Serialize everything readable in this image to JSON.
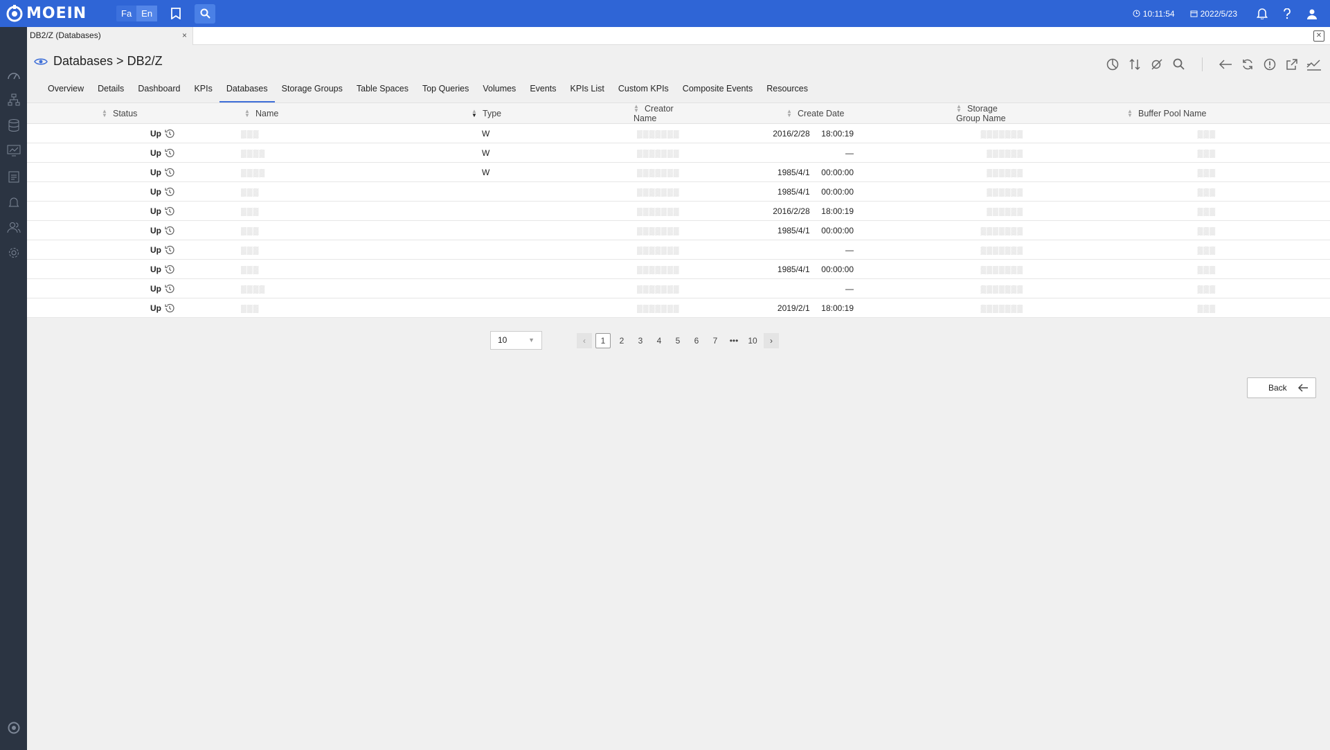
{
  "app": {
    "brand": "MOEIN",
    "langs": [
      "Fa",
      "En"
    ],
    "active_lang": "En",
    "time": "10:11:54",
    "date": "2022/5/23"
  },
  "tab": {
    "title": "DB2/Z (Databases)",
    "close": "×"
  },
  "page": {
    "title": "Databases > DB2/Z"
  },
  "subtabs": [
    "Overview",
    "Details",
    "Dashboard",
    "KPIs",
    "Databases",
    "Storage Groups",
    "Table Spaces",
    "Top Queries",
    "Volumes",
    "Events",
    "KPIs List",
    "Custom KPIs",
    "Composite Events",
    "Resources"
  ],
  "active_subtab": "Databases",
  "columns": [
    "Status",
    "Name",
    "Type",
    "Creator Name",
    "Create Date",
    "Storage Group Name",
    "Buffer Pool Name"
  ],
  "rows": [
    {
      "status": "Up",
      "name": "▒▒▒",
      "type": "W",
      "creator": "▒▒▒▒▒▒▒",
      "date": "2016/2/28     18:00:19",
      "sg": "▒▒▒▒▒▒▒",
      "bp": "▒▒▒"
    },
    {
      "status": "Up",
      "name": "▒▒▒▒",
      "type": "W",
      "creator": "▒▒▒▒▒▒▒",
      "date": "—",
      "sg": "▒▒▒▒▒▒",
      "bp": "▒▒▒"
    },
    {
      "status": "Up",
      "name": "▒▒▒▒",
      "type": "W",
      "creator": "▒▒▒▒▒▒▒",
      "date": "1985/4/1     00:00:00",
      "sg": "▒▒▒▒▒▒",
      "bp": "▒▒▒"
    },
    {
      "status": "Up",
      "name": "▒▒▒",
      "type": "",
      "creator": "▒▒▒▒▒▒▒",
      "date": "1985/4/1     00:00:00",
      "sg": "▒▒▒▒▒▒",
      "bp": "▒▒▒"
    },
    {
      "status": "Up",
      "name": "▒▒▒",
      "type": "",
      "creator": "▒▒▒▒▒▒▒",
      "date": "2016/2/28     18:00:19",
      "sg": "▒▒▒▒▒▒",
      "bp": "▒▒▒"
    },
    {
      "status": "Up",
      "name": "▒▒▒",
      "type": "",
      "creator": "▒▒▒▒▒▒▒",
      "date": "1985/4/1     00:00:00",
      "sg": "▒▒▒▒▒▒▒",
      "bp": "▒▒▒"
    },
    {
      "status": "Up",
      "name": "▒▒▒",
      "type": "",
      "creator": "▒▒▒▒▒▒▒",
      "date": "—",
      "sg": "▒▒▒▒▒▒▒",
      "bp": "▒▒▒"
    },
    {
      "status": "Up",
      "name": "▒▒▒",
      "type": "",
      "creator": "▒▒▒▒▒▒▒",
      "date": "1985/4/1     00:00:00",
      "sg": "▒▒▒▒▒▒▒",
      "bp": "▒▒▒"
    },
    {
      "status": "Up",
      "name": "▒▒▒▒",
      "type": "",
      "creator": "▒▒▒▒▒▒▒",
      "date": "—",
      "sg": "▒▒▒▒▒▒▒",
      "bp": "▒▒▒"
    },
    {
      "status": "Up",
      "name": "▒▒▒",
      "type": "",
      "creator": "▒▒▒▒▒▒▒",
      "date": "2019/2/1     18:00:19",
      "sg": "▒▒▒▒▒▒▒",
      "bp": "▒▒▒"
    }
  ],
  "pagination": {
    "page_size": "10",
    "pages": [
      "1",
      "2",
      "3",
      "4",
      "5",
      "6",
      "7",
      "•••",
      "10"
    ],
    "current": "1"
  },
  "back_label": "Back",
  "colors": {
    "topbar": "#2f65d6",
    "sidebar": "#2b3442",
    "accent": "#3d6ed8"
  }
}
